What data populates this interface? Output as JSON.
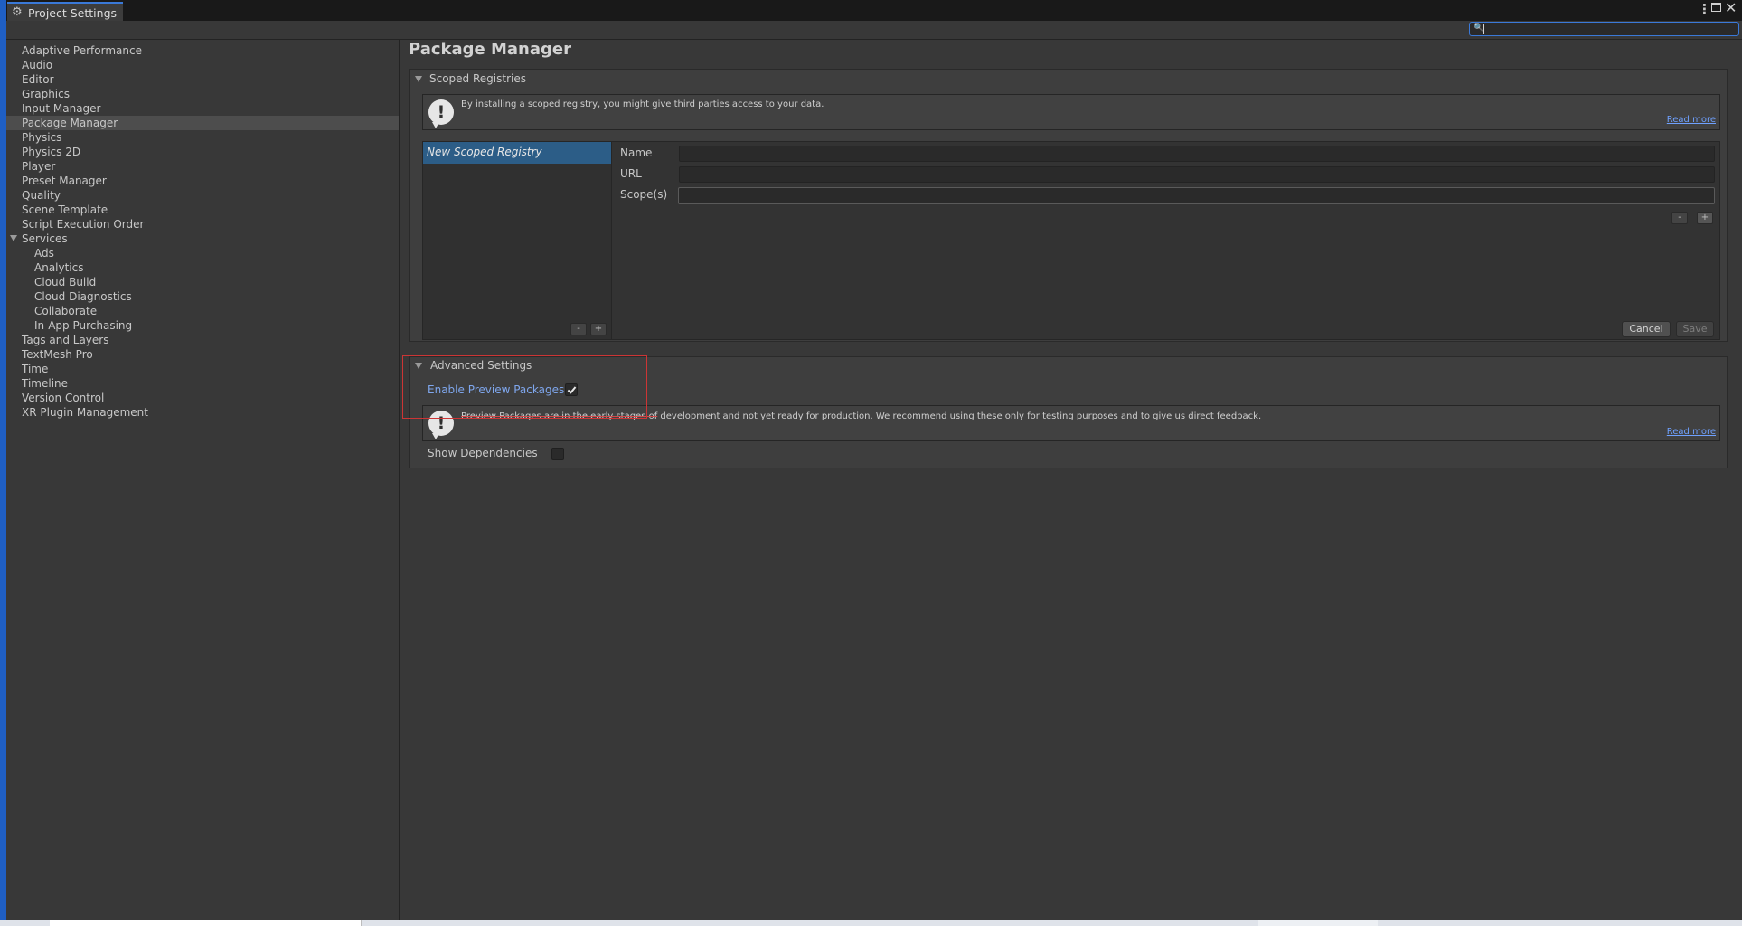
{
  "window": {
    "tab_title": "Project Settings",
    "icons": {
      "tab": "gear-icon",
      "more": "kebab-menu-icon",
      "maximize": "maximize-icon",
      "close": "close-icon"
    },
    "more_glyph": "⋮",
    "close_glyph": "✕",
    "gear_glyph": "⚙"
  },
  "search": {
    "value": "",
    "placeholder": "",
    "icon": "search-icon",
    "icon_glyph": "🔍"
  },
  "sidebar": {
    "items": [
      {
        "label": "Adaptive Performance",
        "level": 0
      },
      {
        "label": "Audio",
        "level": 0
      },
      {
        "label": "Editor",
        "level": 0
      },
      {
        "label": "Graphics",
        "level": 0
      },
      {
        "label": "Input Manager",
        "level": 0
      },
      {
        "label": "Package Manager",
        "level": 0,
        "selected": true
      },
      {
        "label": "Physics",
        "level": 0
      },
      {
        "label": "Physics 2D",
        "level": 0
      },
      {
        "label": "Player",
        "level": 0
      },
      {
        "label": "Preset Manager",
        "level": 0
      },
      {
        "label": "Quality",
        "level": 0
      },
      {
        "label": "Scene Template",
        "level": 0
      },
      {
        "label": "Script Execution Order",
        "level": 0
      },
      {
        "label": "Services",
        "level": 0,
        "expanded": true
      },
      {
        "label": "Ads",
        "level": 1
      },
      {
        "label": "Analytics",
        "level": 1
      },
      {
        "label": "Cloud Build",
        "level": 1
      },
      {
        "label": "Cloud Diagnostics",
        "level": 1
      },
      {
        "label": "Collaborate",
        "level": 1
      },
      {
        "label": "In-App Purchasing",
        "level": 1
      },
      {
        "label": "Tags and Layers",
        "level": 0
      },
      {
        "label": "TextMesh Pro",
        "level": 0
      },
      {
        "label": "Time",
        "level": 0
      },
      {
        "label": "Timeline",
        "level": 0
      },
      {
        "label": "Version Control",
        "level": 0
      },
      {
        "label": "XR Plugin Management",
        "level": 0
      }
    ]
  },
  "main": {
    "page_title": "Package Manager",
    "scoped_registries": {
      "header": "Scoped Registries",
      "help_text": "By installing a scoped registry, you might give third parties access to your data.",
      "read_more": "Read more",
      "registry_list": [
        "New Scoped Registry"
      ],
      "list_minus": "-",
      "list_plus": "+",
      "fields": {
        "name_label": "Name",
        "name_value": "",
        "url_label": "URL",
        "url_value": "",
        "scopes_label": "Scope(s)",
        "scopes_value": ""
      },
      "scope_minus": "-",
      "scope_plus": "+",
      "cancel_label": "Cancel",
      "save_label": "Save"
    },
    "advanced_settings": {
      "header": "Advanced Settings",
      "enable_preview_label": "Enable Preview Packages",
      "enable_preview_checked": true,
      "help_text_struck": "Preview Packages are in the early stages of",
      "help_text_rest": " development and not yet ready for production. We recommend using these only for testing purposes and to give us direct feedback.",
      "read_more": "Read more",
      "show_dependencies_label": "Show Dependencies",
      "show_dependencies_checked": false
    }
  },
  "colors": {
    "accent": "#3a79d8",
    "selection": "#2c5d87",
    "link": "#6fa1ff",
    "highlight": "#cc3535",
    "background": "#383838"
  }
}
